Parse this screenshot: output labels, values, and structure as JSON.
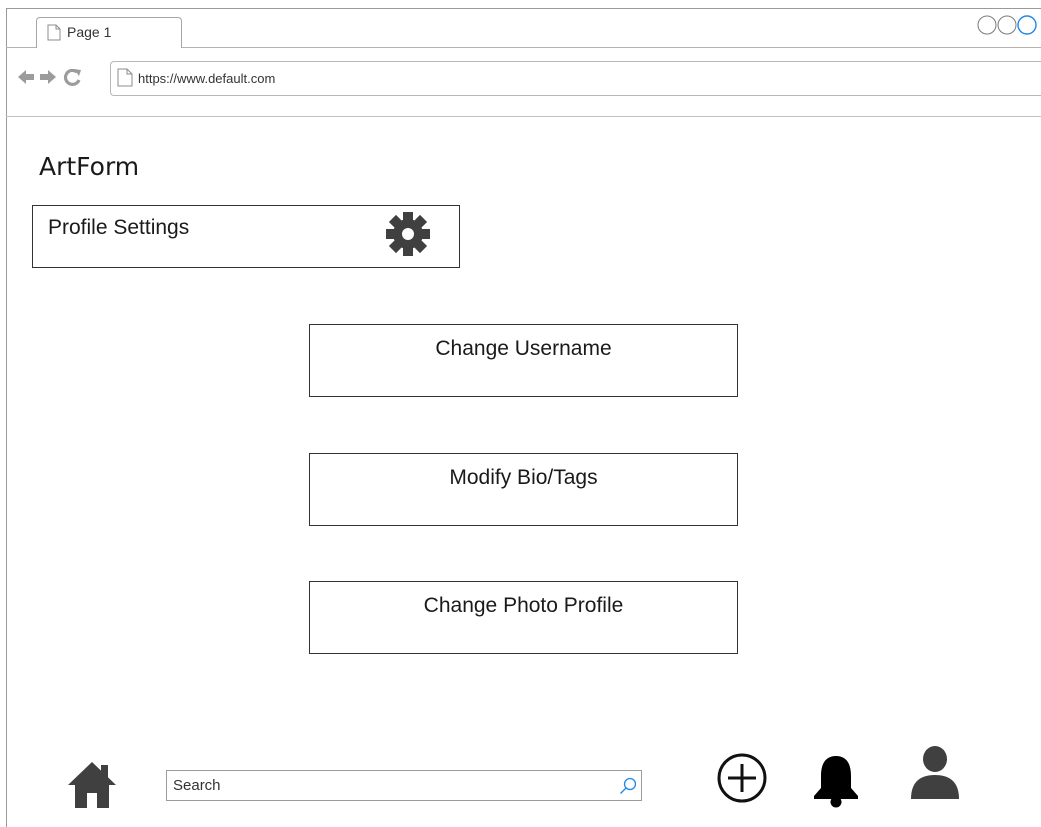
{
  "browser": {
    "tab_label": "Page 1",
    "url": "https://www.default.com"
  },
  "app": {
    "title": "ArtForm"
  },
  "settings": {
    "header_label": "Profile Settings",
    "icon": "gear-icon"
  },
  "actions": [
    {
      "label": "Change Username"
    },
    {
      "label": "Modify Bio/Tags"
    },
    {
      "label": "Change Photo Profile"
    }
  ],
  "bottom_nav": {
    "home_icon": "home-icon",
    "search_placeholder": "Search",
    "search_icon": "search-icon",
    "add_icon": "add-circle-icon",
    "bell_icon": "bell-icon",
    "user_icon": "user-icon"
  },
  "colors": {
    "icon_dark": "#404040",
    "search_icon_accent": "#1e88e5",
    "window_circle_accent": "#1e88e5"
  }
}
